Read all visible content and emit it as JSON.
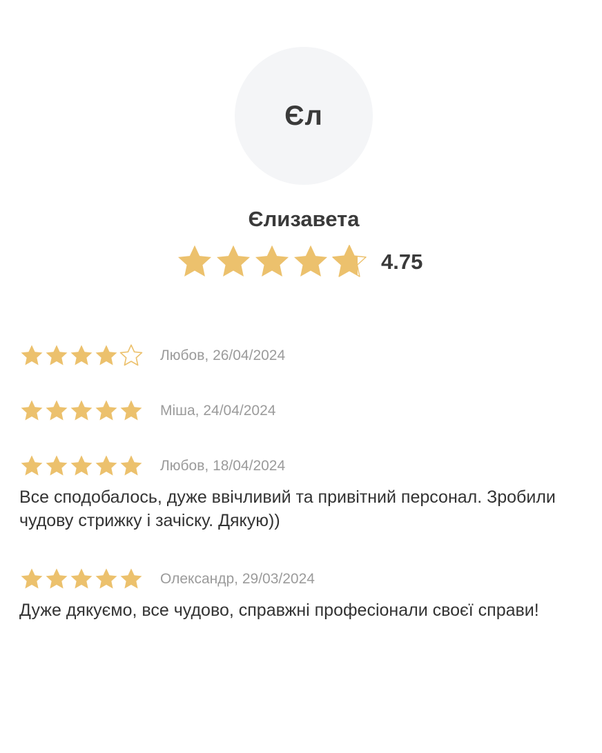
{
  "colors": {
    "star": "#ecc16d",
    "avatar_bg": "#f4f5f7",
    "text_dark": "#3a3a3a",
    "text_muted": "#9b9b9b"
  },
  "profile": {
    "initials": "Єл",
    "name": "Єлизавета",
    "rating": 4.75,
    "rating_label": "4.75",
    "max_stars": 5
  },
  "reviews": [
    {
      "rating": 4,
      "author_date": "Любов, 26/04/2024",
      "text": ""
    },
    {
      "rating": 5,
      "author_date": "Міша, 24/04/2024",
      "text": ""
    },
    {
      "rating": 5,
      "author_date": "Любов, 18/04/2024",
      "text": "Все сподобалось, дуже ввічливий та привітний персонал. Зробили чудову стрижку і зачіску. Дякую))"
    },
    {
      "rating": 5,
      "author_date": "Олександр, 29/03/2024",
      "text": "Дуже дякуємо, все чудово, справжні професіонали своєї справи!"
    }
  ]
}
